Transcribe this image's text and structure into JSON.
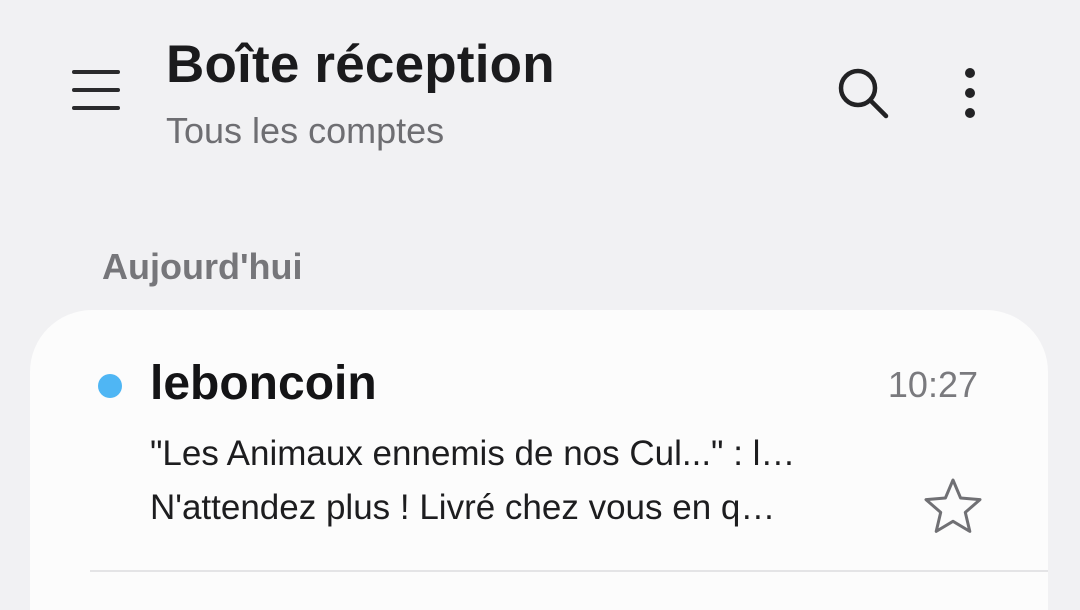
{
  "header": {
    "title": "Boîte réception",
    "subtitle": "Tous les comptes",
    "menu_icon": "hamburger-menu-icon",
    "search_icon": "search-icon",
    "more_icon": "more-vertical-icon"
  },
  "inbox": {
    "section_label": "Aujourd'hui",
    "emails": [
      {
        "unread": true,
        "sender": "leboncoin",
        "time": "10:27",
        "subject": "\"Les Animaux ennemis de nos Cul...\" : l…",
        "preview": "N'attendez plus !  Livré chez vous en q…",
        "starred": false
      }
    ]
  },
  "colors": {
    "background": "#f1f1f3",
    "card": "#fcfcfc",
    "unread_dot": "#4fb6f4",
    "title": "#1b1b1d",
    "secondary_text": "#6e6e72"
  }
}
